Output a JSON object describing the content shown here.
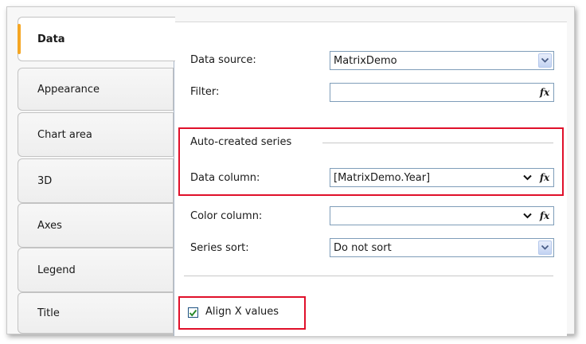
{
  "tabs": [
    {
      "label": "Data",
      "active": true
    },
    {
      "label": "Appearance",
      "active": false
    },
    {
      "label": "Chart area",
      "active": false
    },
    {
      "label": "3D",
      "active": false
    },
    {
      "label": "Axes",
      "active": false
    },
    {
      "label": "Legend",
      "active": false
    },
    {
      "label": "Title",
      "active": false
    }
  ],
  "data_source": {
    "label": "Data source:",
    "value": "MatrixDemo"
  },
  "filter": {
    "label": "Filter:",
    "value": ""
  },
  "auto_series": {
    "group_label": "Auto-created series",
    "data_column": {
      "label": "Data column:",
      "value": "[MatrixDemo.Year]"
    },
    "color_column": {
      "label": "Color column:",
      "value": ""
    },
    "series_sort": {
      "label": "Series sort:",
      "value": "Do not sort"
    }
  },
  "align_x": {
    "label": "Align X values",
    "checked": true
  },
  "fx_symbol": "fx",
  "colors": {
    "highlight": "#e0102a",
    "accent_tab": "#f5a623",
    "check": "#2a8a2a"
  }
}
